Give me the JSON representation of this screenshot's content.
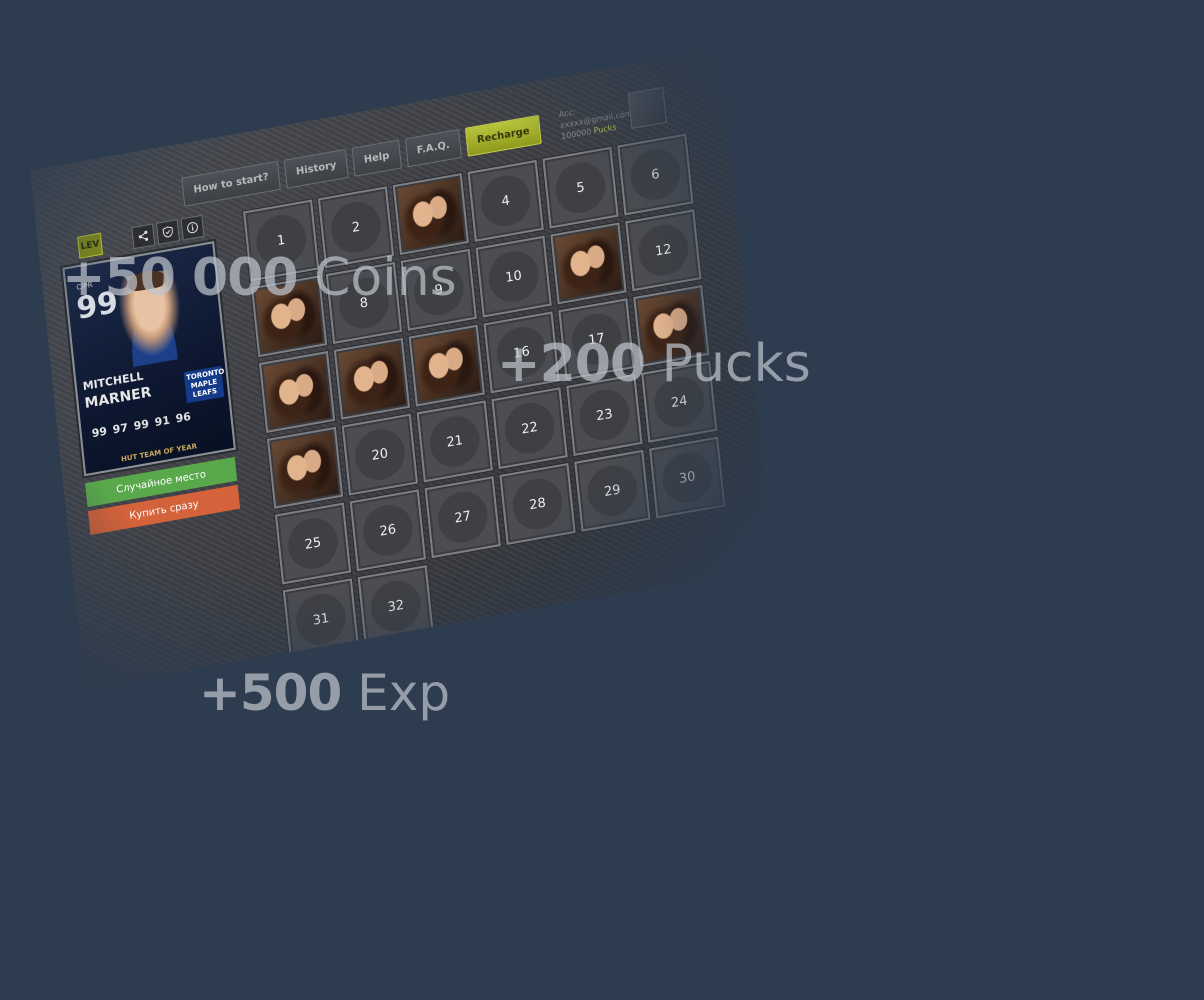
{
  "nav": {
    "tabs": [
      "How to start?",
      "History",
      "Help",
      "F.A.Q."
    ],
    "recharge_label": "Recharge",
    "account_label": "Acc:",
    "account_email": "xxxxx@gmail.com",
    "account_balance": "100000",
    "account_currency": "Pucks"
  },
  "card": {
    "overall": "99",
    "position": "C/PR",
    "first_name": "MITCHELL",
    "last_name": "MARNER",
    "team": "TORONTO MAPLE LEAFS",
    "stats": [
      "99",
      "97",
      "99",
      "91",
      "96"
    ],
    "footer": "HUT TEAM OF YEAR",
    "level_badge": "LEV"
  },
  "panel": {
    "random_button": "Случайное место",
    "buy_button": "Купить сразу"
  },
  "grid": {
    "cells": [
      {
        "n": "1"
      },
      {
        "n": "2"
      },
      {
        "photo": true
      },
      {
        "n": "4"
      },
      {
        "n": "5"
      },
      {
        "n": "6"
      },
      {
        "photo": true
      },
      {
        "n": "8"
      },
      {
        "n": "9"
      },
      {
        "n": "10"
      },
      {
        "photo": true
      },
      {
        "n": "12"
      },
      {
        "photo": true
      },
      {
        "photo": true
      },
      {
        "photo": true
      },
      {
        "n": "16"
      },
      {
        "n": "17"
      },
      {
        "photo": true
      },
      {
        "photo": true
      },
      {
        "n": "20"
      },
      {
        "n": "21"
      },
      {
        "n": "22"
      },
      {
        "n": "23"
      },
      {
        "n": "24"
      },
      {
        "n": "25"
      },
      {
        "n": "26"
      },
      {
        "n": "27"
      },
      {
        "n": "28"
      },
      {
        "n": "29"
      },
      {
        "n": "30"
      },
      {
        "n": "31"
      },
      {
        "n": "32"
      }
    ]
  },
  "rewards": {
    "coins_amount": "+50 000",
    "coins_unit": "Coins",
    "pucks_amount": "+200",
    "pucks_unit": "Pucks",
    "exp_amount": "+500",
    "exp_unit": "Exp"
  }
}
